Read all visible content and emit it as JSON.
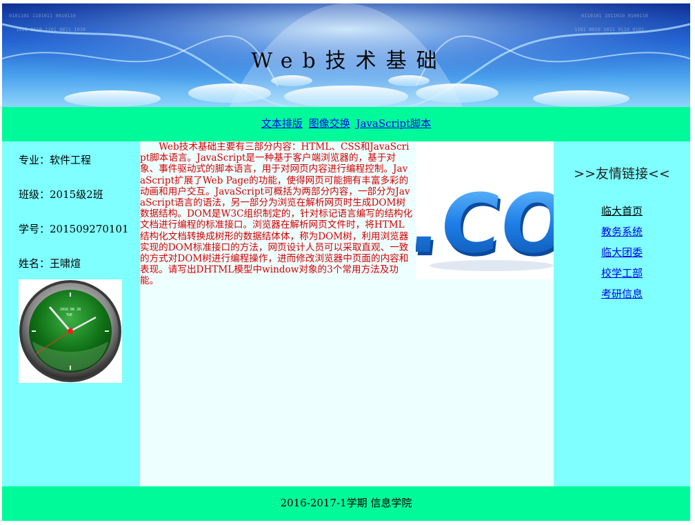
{
  "header": {
    "title": "Web技术基础"
  },
  "nav": {
    "items": [
      "文本排版",
      "图像交换",
      "JavaScript脚本"
    ]
  },
  "left": {
    "major_label": "专业：",
    "major_value": "软件工程",
    "class_label": "班级：",
    "class_value": "2015级2班",
    "id_label": "学号：",
    "id_value": "201509270101",
    "name_label": "姓名：",
    "name_value": "王啸煊",
    "clock_icon": "analog-clock-icon"
  },
  "main": {
    "image_label": ".COM",
    "paragraph": "Web技术基础主要有三部分内容：HTML、CSS和JavaScript脚本语言。JavaScript是一种基于客户端浏览器的，基于对象、事件驱动式的脚本语言，用于对网页内容进行编程控制。JavaScript扩展了Web Page的功能，使得网页可能拥有丰富多彩的动画和用户交互。JavaScript可概括为两部分内容，一部分为JavaScript语言的语法，另一部分为浏览在解析网页时生成DOM树数据结构。DOM是W3C组织制定的，针对标记语言编写的结构化文档进行编程的标准接口。浏览器在解析网页文件时，将HTML结构化文档转换成树形的数据结体体，称为DOM树，利用浏览器实现的DOM标准接口的方法，网页设计人员可以采取直观、一致的方式对DOM树进行编程操作，进而修改浏览器中页面的内容和表现。请写出DHTML模型中window对象的3个常用方法及功能。"
  },
  "right": {
    "title": ">>友情链接<<",
    "links": [
      "临大首页",
      "教务系统",
      "临大团委",
      "校学工部",
      "考研信息"
    ]
  },
  "footer": {
    "text": "2016-2017-1学期 信息学院"
  },
  "colors": {
    "nav_bg": "#00fa9a",
    "side_bg": "#7fffff",
    "main_bg": "#eeffff",
    "text_red": "#d40000",
    "link_blue": "#0000ee"
  }
}
